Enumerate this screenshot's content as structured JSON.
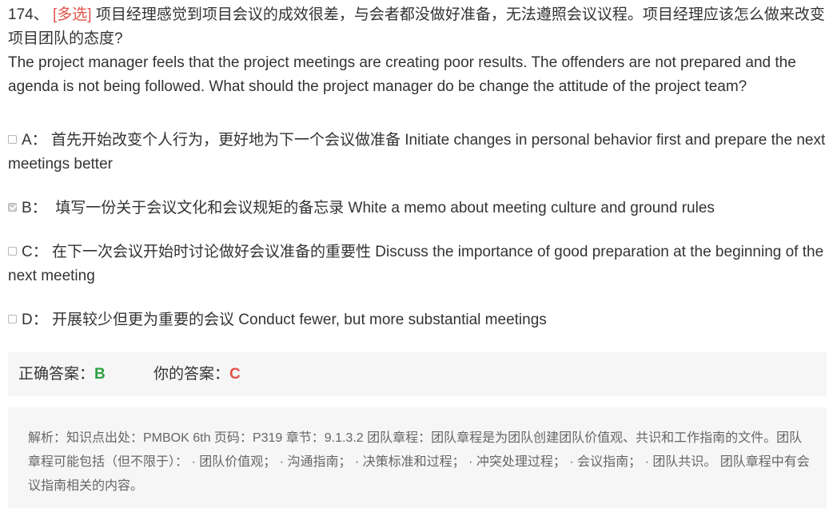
{
  "question": {
    "number": "174、",
    "type_tag": "[多选]",
    "text_cn": "项目经理感觉到项目会议的成效很差，与会者都没做好准备，无法遵照会议议程。项目经理应该怎么做来改变项目团队的态度?",
    "text_en": "The project manager feels that the project meetings are creating poor results. The offenders are not prepared and the agenda is not being followed. What should the project manager do be change the attitude of the project team?"
  },
  "options": [
    {
      "letter": "A：",
      "text": "首先开始改变个人行为，更好地为下一个会议做准备 Initiate changes in personal behavior first and prepare the next meetings better",
      "checked": false
    },
    {
      "letter": "B：",
      "text": "填写一份关于会议文化和会议规矩的备忘录 White a memo about meeting culture and ground rules",
      "checked": true
    },
    {
      "letter": "C：",
      "text": "在下一次会议开始时讨论做好会议准备的重要性 Discuss the importance of good preparation at the beginning of the next meeting",
      "checked": false
    },
    {
      "letter": "D：",
      "text": "开展较少但更为重要的会议 Conduct fewer, but more substantial meetings",
      "checked": false
    }
  ],
  "answer": {
    "correct_label": "正确答案：",
    "correct_value": "B",
    "yours_label": "你的答案：",
    "yours_value": "C",
    "correct_color": "#2ea043",
    "yours_color": "#e2534b"
  },
  "analysis": {
    "text": "解析：知识点出处：PMBOK 6th 页码：P319 章节：9.1.3.2 团队章程：团队章程是为团队创建团队价值观、共识和工作指南的文件。团队章程可能包括（但不限于）： · 团队价值观； · 沟通指南； · 决策标准和过程； · 冲突处理过程； · 会议指南； · 团队共识。 团队章程中有会议指南相关的内容。"
  }
}
